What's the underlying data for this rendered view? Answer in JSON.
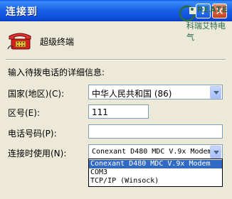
{
  "window": {
    "title": "连接到",
    "help_glyph": "?",
    "close_glyph": "✕"
  },
  "logo": {
    "word": "REATE",
    "company": "科瑞艾特电气"
  },
  "connection": {
    "name": "超级终端"
  },
  "form": {
    "instruction": "输入待拨电话的详细信息:",
    "country_label": "国家(地区)(C):",
    "country_value": "中华人民共和国 (86)",
    "area_label": "区号(E):",
    "area_value": "111",
    "phone_label": "电话号码(P):",
    "phone_value": "",
    "connect_label": "连接时使用(N):",
    "connect_value": "Conexant D480 MDC V.9x Modem",
    "connect_options": [
      "Conexant D480 MDC V.9x Modem",
      "COM3",
      "TCP/IP (Winsock)"
    ]
  }
}
